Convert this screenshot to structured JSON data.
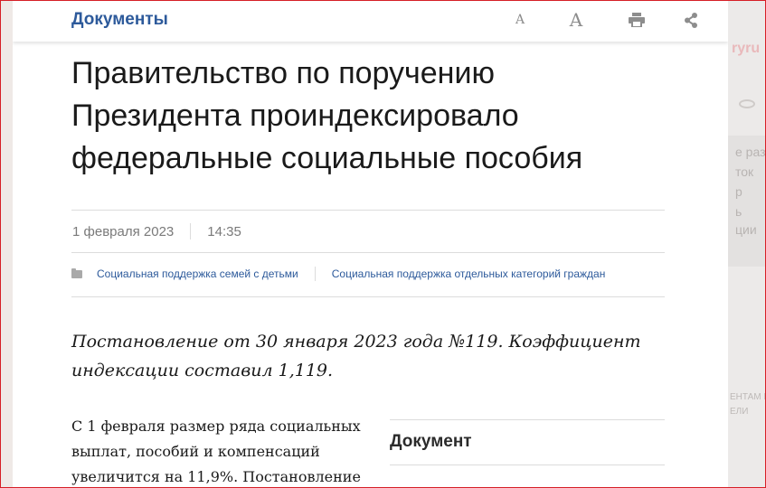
{
  "topbar": {
    "section_title": "Документы",
    "font_small_label": "A",
    "font_large_label": "A",
    "icons": [
      "font-decrease-icon",
      "font-increase-icon",
      "print-icon",
      "share-icon"
    ]
  },
  "article": {
    "title": "Правительство по поручению Президента проиндексировало федеральные социальные пособия",
    "date": "1 февраля 2023",
    "time": "14:35",
    "tags": [
      "Социальная поддержка семей с детьми",
      "Социальная поддержка отдельных категорий граждан"
    ],
    "lead": "Постановление от 30 января 2023 года №119. Коэффициент индексации составил 1,119.",
    "body": "С 1 февраля размер ряда социальных выплат, пособий и компенсаций увеличится на 11,9%. Постановление",
    "document_box_title": "Документ"
  },
  "background": {
    "brand_fragment": "ryru",
    "side_lines": [
      "е раз",
      "ток",
      "р",
      "ь",
      "ции"
    ],
    "footer_lines": [
      "ЕНТАМ И",
      "ЕЛИ"
    ]
  },
  "colors": {
    "accent": "#2d5a9b",
    "text": "#1a1a1a",
    "muted": "#7a7a7a",
    "frame": "#d61f26"
  }
}
